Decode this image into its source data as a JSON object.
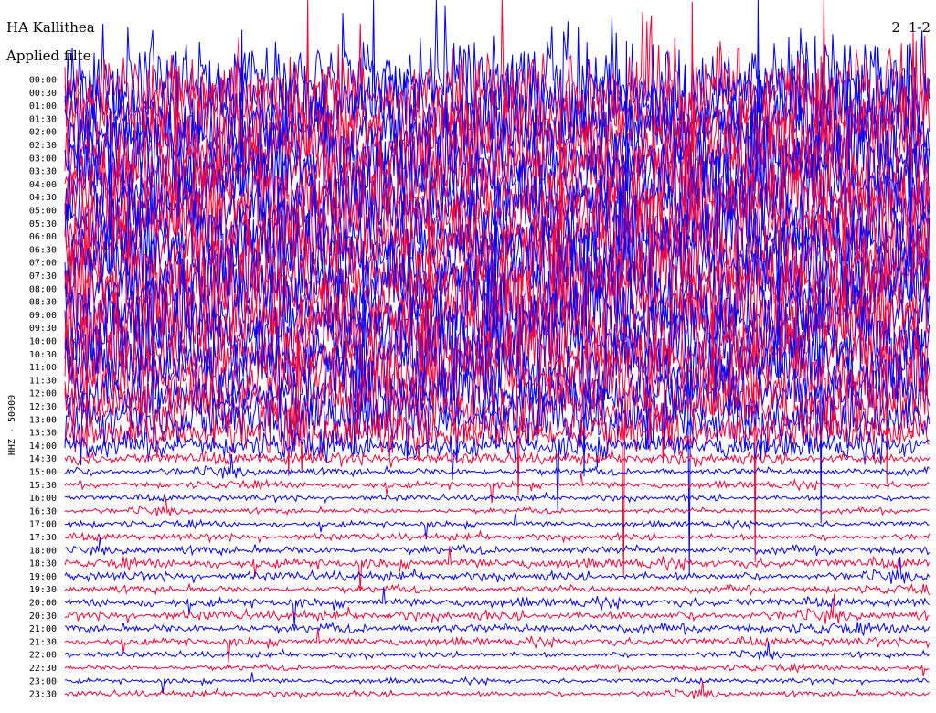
{
  "header": {
    "station": "HA Kallithea",
    "filter": "Applied filte",
    "date": "2   1-2"
  },
  "colors": {
    "trace_a": "#0000ff",
    "trace_b": "#ff0033",
    "background": "#ffffff",
    "text": "#000000"
  },
  "chart_data": {
    "type": "helicorder",
    "ylabel": "HHZ - 50000",
    "row_labels": [
      "00:00",
      "00:30",
      "01:00",
      "01:30",
      "02:00",
      "02:30",
      "03:00",
      "03:30",
      "04:00",
      "04:30",
      "05:00",
      "05:30",
      "06:00",
      "06:30",
      "07:00",
      "07:30",
      "08:00",
      "08:30",
      "09:00",
      "09:30",
      "10:00",
      "10:30",
      "11:00",
      "11:30",
      "12:00",
      "12:30",
      "13:00",
      "13:30",
      "14:00",
      "14:30",
      "15:00",
      "15:30",
      "16:00",
      "16:30",
      "17:00",
      "17:30",
      "18:00",
      "18:30",
      "19:00",
      "19:30",
      "20:00",
      "20:30",
      "21:00",
      "21:30",
      "22:00",
      "22:30",
      "23:00",
      "23:30"
    ],
    "minutes_per_row": 30,
    "trace_colors": [
      "#0000ff",
      "#ff0033"
    ],
    "amplitude_per_row": [
      9,
      9,
      9,
      9,
      9,
      9,
      9,
      9,
      9,
      9,
      9,
      9,
      9,
      9,
      9,
      9,
      9,
      9,
      9,
      9,
      8.5,
      8,
      8,
      7.5,
      7,
      6.5,
      6,
      5,
      2.5,
      1.2,
      0.8,
      0.7,
      0.6,
      0.6,
      0.6,
      0.7,
      0.9,
      1.0,
      0.9,
      0.8,
      0.9,
      1.0,
      1.0,
      0.8,
      0.6,
      0.6,
      0.5,
      0.6
    ],
    "grid": false
  }
}
